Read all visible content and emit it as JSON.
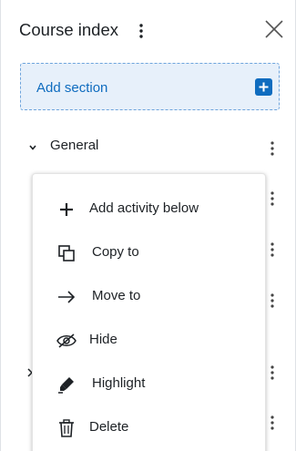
{
  "header": {
    "title": "Course index"
  },
  "add_section": {
    "label": "Add section"
  },
  "sections": [
    {
      "label": "General",
      "expanded": true
    }
  ],
  "context_menu": {
    "items": [
      {
        "label": "Add activity below",
        "icon": "plus-icon"
      },
      {
        "label": "Copy to",
        "icon": "copy-icon"
      },
      {
        "label": "Move to",
        "icon": "arrow-right-icon"
      },
      {
        "label": "Hide",
        "icon": "eye-slash-icon"
      },
      {
        "label": "Highlight",
        "icon": "marker-icon"
      },
      {
        "label": "Delete",
        "icon": "trash-icon"
      }
    ]
  },
  "colors": {
    "accent": "#0f6cbf",
    "add_section_bg": "#e7f0fa",
    "add_section_border": "#6ea4dc",
    "text": "#1d2125"
  }
}
